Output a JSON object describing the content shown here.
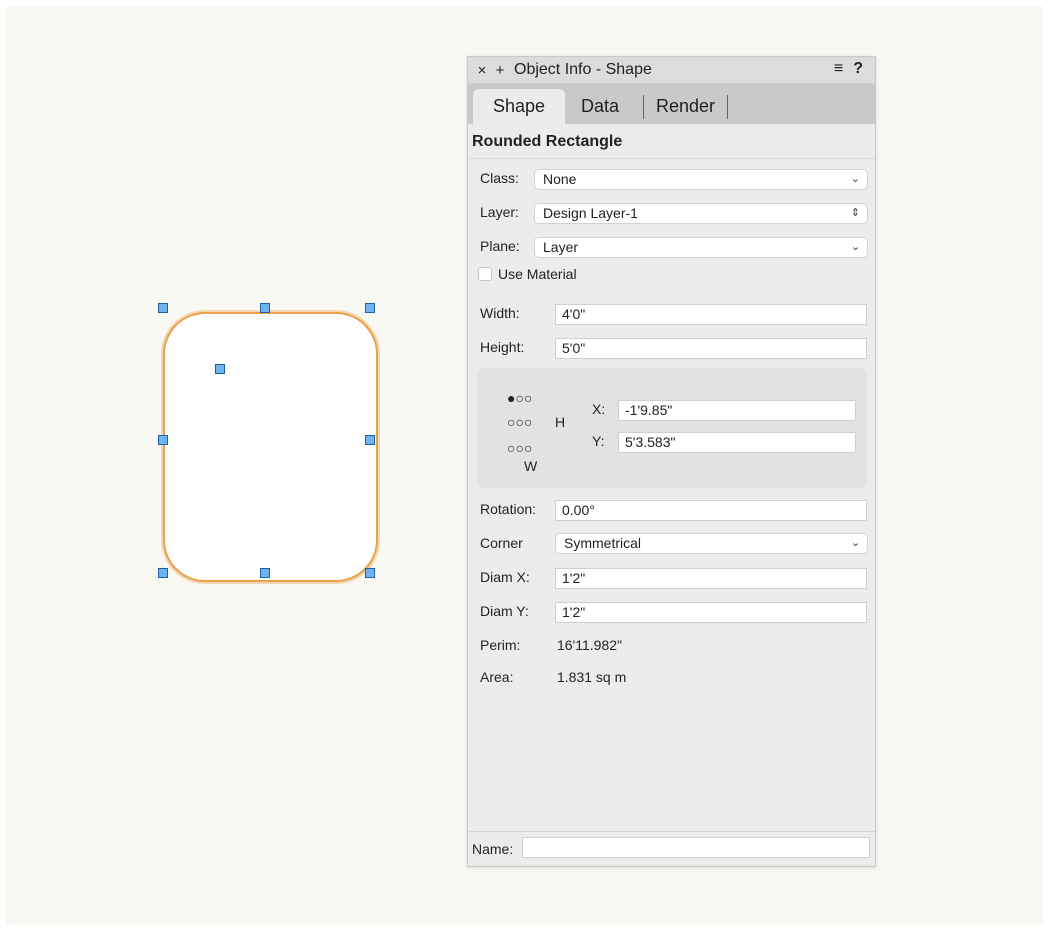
{
  "panel": {
    "title": "Object Info - Shape",
    "close_glyph": "×",
    "add_glyph": "+",
    "menu_glyph": "≡",
    "help_glyph": "?",
    "tabs": [
      "Shape",
      "Data",
      "Render"
    ],
    "object_type": "Rounded Rectangle"
  },
  "fields": {
    "class_label": "Class:",
    "class_value": "None",
    "layer_label": "Layer:",
    "layer_value": "Design Layer-1",
    "plane_label": "Plane:",
    "plane_value": "Layer",
    "use_material_label": "Use Material",
    "width_label": "Width:",
    "width_value": "4'0\"",
    "height_label": "Height:",
    "height_value": "5'0\"",
    "x_label": "X:",
    "x_value": "-1'9.85\"",
    "y_label": "Y:",
    "y_value": "5'3.583\"",
    "h_label": "H",
    "w_label": "W",
    "anchor_rows": [
      "●○○",
      "○○○",
      "○○○"
    ],
    "rotation_label": "Rotation:",
    "rotation_value": "0.00°",
    "corner_label": "Corner",
    "corner_value": "Symmetrical",
    "diamx_label": "Diam X:",
    "diamx_value": "1'2\"",
    "diamy_label": "Diam Y:",
    "diamy_value": "1'2\"",
    "perim_label": "Perim:",
    "perim_value": "16'11.982\"",
    "area_label": "Area:",
    "area_value": "1.831 sq m",
    "name_label": "Name:",
    "name_value": ""
  },
  "colors": {
    "selection_outline": "#e9a14c",
    "handle_fill": "#6fb3ee",
    "canvas_bg": "#f9f8f3",
    "panel_bg": "#ececec"
  }
}
